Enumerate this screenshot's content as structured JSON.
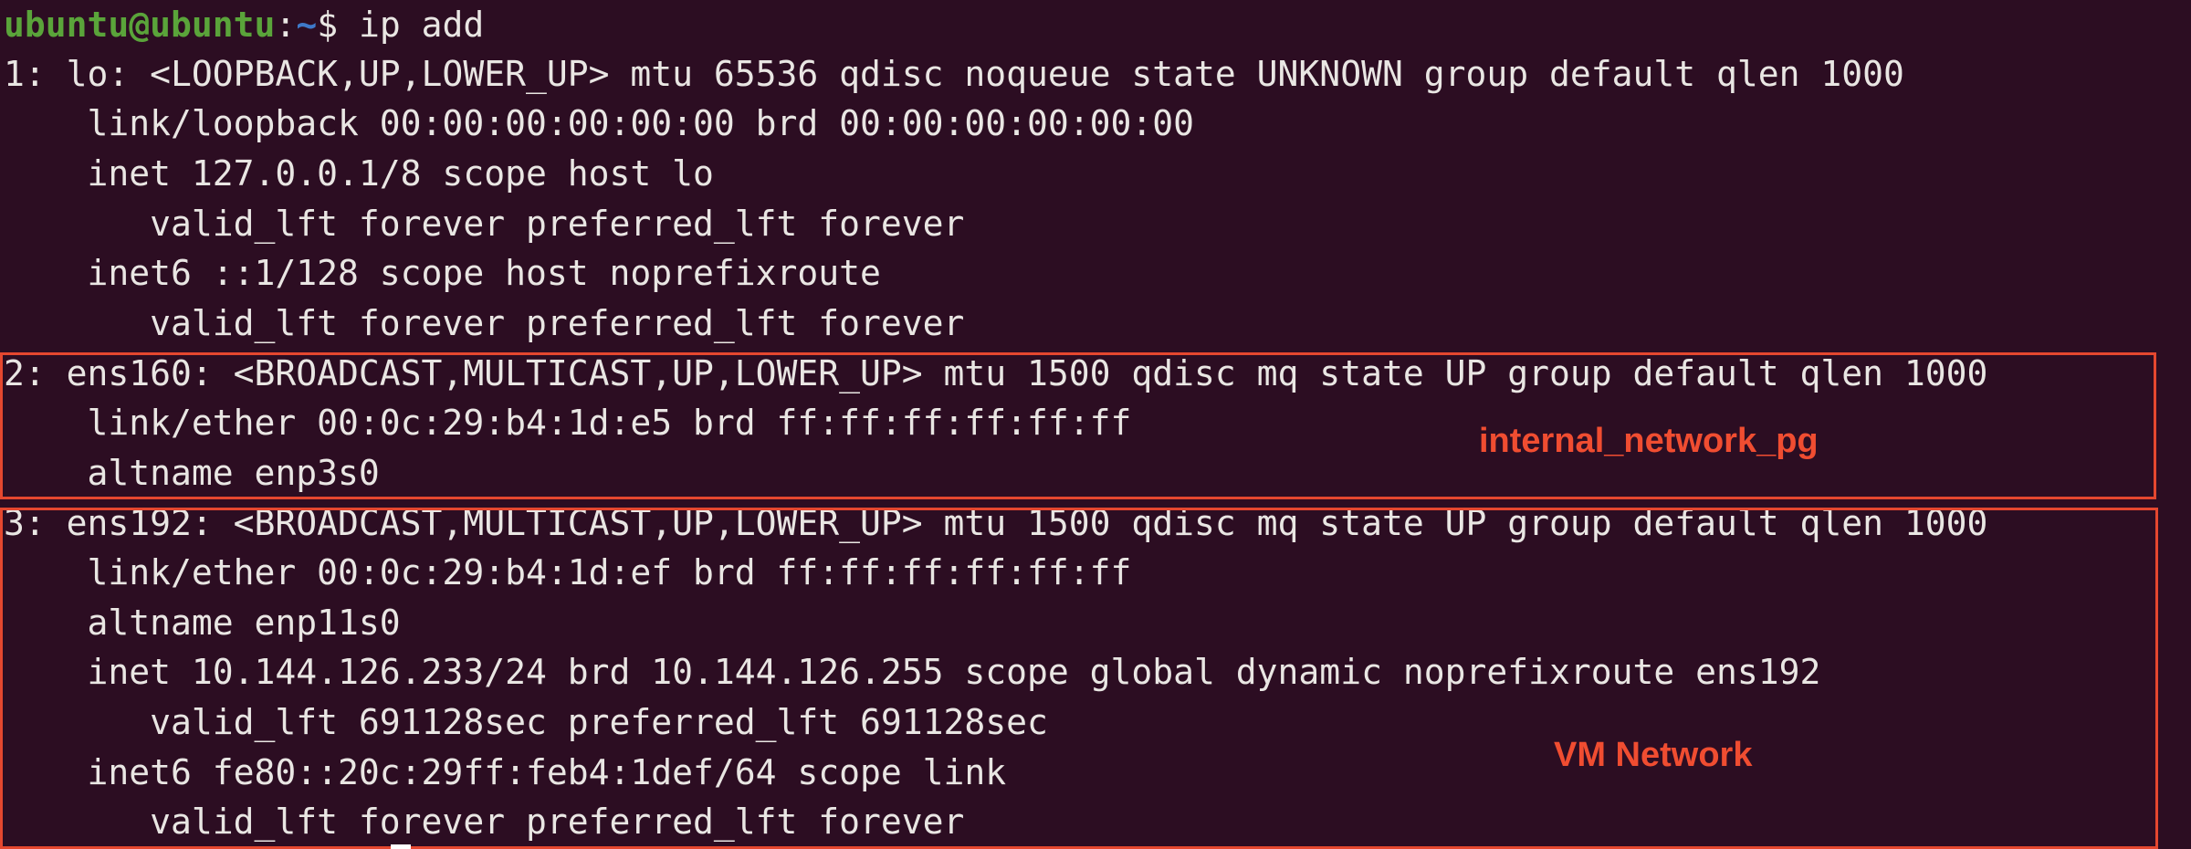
{
  "prompt": {
    "user": "ubuntu@ubuntu",
    "colon": ":",
    "path": "~",
    "symbol": "$ ",
    "command": "ip add"
  },
  "output": [
    "1: lo: <LOOPBACK,UP,LOWER_UP> mtu 65536 qdisc noqueue state UNKNOWN group default qlen 1000",
    "    link/loopback 00:00:00:00:00:00 brd 00:00:00:00:00:00",
    "    inet 127.0.0.1/8 scope host lo",
    "       valid_lft forever preferred_lft forever",
    "    inet6 ::1/128 scope host noprefixroute",
    "       valid_lft forever preferred_lft forever",
    "2: ens160: <BROADCAST,MULTICAST,UP,LOWER_UP> mtu 1500 qdisc mq state UP group default qlen 1000",
    "    link/ether 00:0c:29:b4:1d:e5 brd ff:ff:ff:ff:ff:ff",
    "    altname enp3s0",
    "3: ens192: <BROADCAST,MULTICAST,UP,LOWER_UP> mtu 1500 qdisc mq state UP group default qlen 1000",
    "    link/ether 00:0c:29:b4:1d:ef brd ff:ff:ff:ff:ff:ff",
    "    altname enp11s0",
    "    inet 10.144.126.233/24 brd 10.144.126.255 scope global dynamic noprefixroute ens192",
    "       valid_lft 691128sec preferred_lft 691128sec",
    "    inet6 fe80::20c:29ff:feb4:1def/64 scope link",
    "       valid_lft forever preferred_lft forever"
  ],
  "annotations": {
    "ens160_label": "internal_network_pg",
    "ens192_label": "VM Network"
  },
  "colors": {
    "background": "#2c0d22",
    "text": "#e9e6e3",
    "prompt_user": "#5aa43a",
    "prompt_path": "#3e79c9",
    "annotation": "#e5472f"
  }
}
